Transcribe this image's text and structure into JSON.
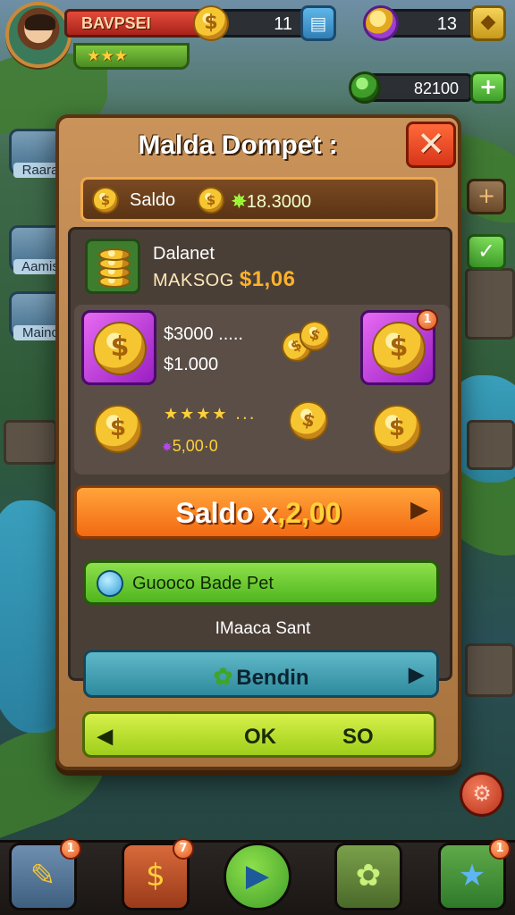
{
  "hud": {
    "player_name": "BAVPSEI",
    "player_stars": "★★★",
    "coins": "11",
    "gems": "13",
    "green_currency": "82100"
  },
  "side_left": [
    {
      "label": "Raara"
    },
    {
      "label": "Aamis"
    },
    {
      "label": "Mainc"
    }
  ],
  "dialog": {
    "title": "Malda Dompet :",
    "close_glyph": "✕",
    "saldo_label": "Saldo",
    "saldo_value_prefix": "✵",
    "saldo_value": "18.3000",
    "balance_title": "Dalanet",
    "balance_sub_label": "MAKSOG",
    "balance_sub_value": "$1,06",
    "rewards": {
      "amount_1": "$3000 .....",
      "amount_2": "$1.000",
      "stars": "★★★★  ...",
      "bonus_prefix": "✸",
      "bonus": "5,00·0",
      "badge": "1"
    },
    "primary_button": {
      "label": "Saldo x",
      "value": ",2,00",
      "arrow": "▶"
    },
    "green_button": {
      "label": "Guooco Bade Pet"
    },
    "subtitle": "IMaaca Sant",
    "teal_button": {
      "label": "Bendin",
      "arrow": "▶"
    },
    "ok_button": {
      "arrow": "◀",
      "label": "OK",
      "value": "SO"
    }
  },
  "nav": {
    "items": [
      {
        "name": "edit",
        "badge": "1"
      },
      {
        "name": "shop",
        "badge": "7"
      },
      {
        "name": "play"
      },
      {
        "name": "map"
      },
      {
        "name": "favorites",
        "badge": "1"
      }
    ]
  },
  "colors": {
    "dialog_frame": "#a8733e",
    "primary": "#f36a12",
    "green": "#4fb61f",
    "teal": "#2f8a9d",
    "lime": "#9fce1a"
  }
}
